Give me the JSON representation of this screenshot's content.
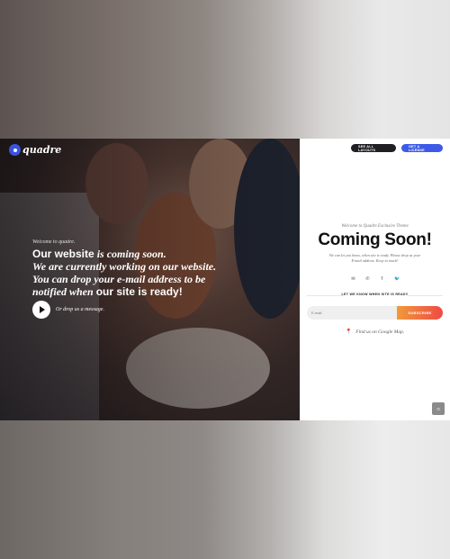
{
  "brand": {
    "name": "quadre",
    "accent": "#3e5be8"
  },
  "hero": {
    "welcome": "Welcome to quadre.",
    "headline": [
      {
        "a": "Our website",
        "b": " is coming soon."
      },
      {
        "a": "",
        "b": "We are currently working on our website."
      },
      {
        "a": "",
        "b": "You can drop your e-mail address to be"
      },
      {
        "a": "",
        "b": "notified when ",
        "c": "our site is ready!"
      }
    ],
    "play_label": "Or drop us a message."
  },
  "panel": {
    "buttons": {
      "layouts": "SEE ALL LAYOUTS",
      "license": "GET A LICENSE"
    },
    "welcome": "Welcome to Quadre Exclusive Theme",
    "title": "Coming Soon!",
    "text_line1": "We can let you know, when site is ready. Please drop us your",
    "text_line2": "E-mail address. Keep in touch!",
    "social_icons": [
      "mail-icon",
      "phone-icon",
      "facebook-icon",
      "twitter-icon"
    ],
    "letknow": "LET WE KNOW WHEN SITE IS READY",
    "email_placeholder": "E-mail",
    "subscribe": "SUBSCRIBE",
    "map_link": "Find us on Google Map.",
    "corner": "⊡"
  },
  "colors": {
    "subscribe_from": "#f19a3a",
    "subscribe_to": "#ef4a45",
    "dark_button": "#1f1f24"
  }
}
